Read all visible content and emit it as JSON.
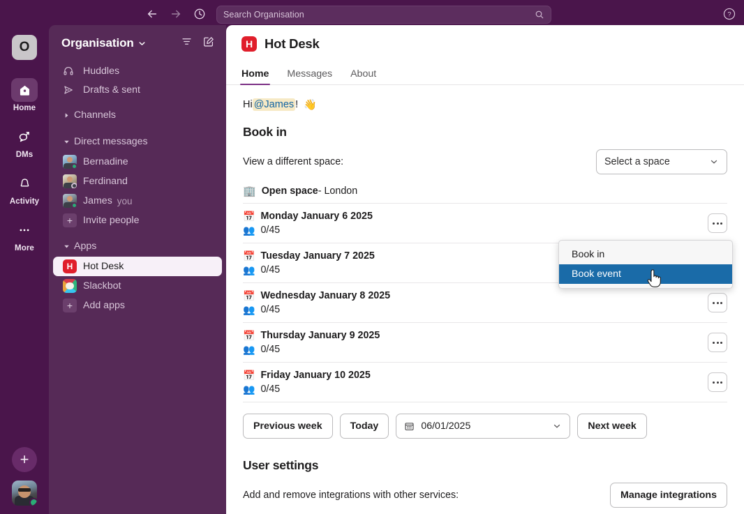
{
  "topbar": {
    "back_icon": "arrow-left-icon",
    "forward_icon": "arrow-right-icon",
    "history_icon": "clock-icon",
    "search_placeholder": "Search Organisation",
    "search_icon": "search-icon",
    "help_label": "?"
  },
  "rail": {
    "workspace_initial": "O",
    "items": [
      {
        "label": "Home",
        "icon": "home-icon",
        "active": true
      },
      {
        "label": "DMs",
        "icon": "dm-icon",
        "active": false
      },
      {
        "label": "Activity",
        "icon": "bell-icon",
        "active": false
      },
      {
        "label": "More",
        "icon": "ellipsis-icon",
        "active": false
      }
    ],
    "new_label": "+"
  },
  "sidebar": {
    "title": "Organisation",
    "caret_icon": "chevron-down-icon",
    "filter_icon": "filter-icon",
    "compose_icon": "compose-icon",
    "top_items": [
      {
        "label": "Huddles",
        "icon": "headphones-icon"
      },
      {
        "label": "Drafts & sent",
        "icon": "paper-plane-icon"
      }
    ],
    "channels_section": {
      "label": "Channels",
      "expanded": false
    },
    "dm_section": {
      "label": "Direct messages",
      "expanded": true
    },
    "dms": [
      {
        "label": "Bernadine",
        "presence": "active",
        "suffix": ""
      },
      {
        "label": "Ferdinand",
        "presence": "away",
        "suffix": ""
      },
      {
        "label": "James",
        "presence": "active",
        "suffix": "you"
      }
    ],
    "invite_label": "Invite people",
    "apps_section": {
      "label": "Apps",
      "expanded": true
    },
    "apps": [
      {
        "label": "Hot Desk",
        "icon": "hot-desk-app-icon",
        "active": true
      },
      {
        "label": "Slackbot",
        "icon": "slackbot-icon",
        "active": false
      }
    ],
    "add_apps_label": "Add apps"
  },
  "main": {
    "app_title": "Hot Desk",
    "app_initial": "H",
    "tabs": [
      {
        "label": "Home",
        "active": true
      },
      {
        "label": "Messages",
        "active": false
      },
      {
        "label": "About",
        "active": false
      }
    ],
    "greeting_prefix": "Hi ",
    "greeting_mention": "@James",
    "greeting_suffix": "!",
    "greeting_emoji": "👋",
    "book_in_heading": "Book in",
    "view_space_label": "View a different space:",
    "space_select_value": "Select a space",
    "space_select_caret": "chevron-down-icon",
    "space_emoji": "🏢",
    "space_name": "Open space",
    "space_location": " - London",
    "day_emoji": "📅",
    "people_emoji": "👥",
    "days": [
      {
        "date": "Monday January 6 2025",
        "count": "0/45"
      },
      {
        "date": "Tuesday January 7 2025",
        "count": "0/45"
      },
      {
        "date": "Wednesday January 8 2025",
        "count": "0/45"
      },
      {
        "date": "Thursday January 9 2025",
        "count": "0/45"
      },
      {
        "date": "Friday January 10 2025",
        "count": "0/45"
      }
    ],
    "prev_week_label": "Previous week",
    "today_label": "Today",
    "date_value": "06/01/2025",
    "date_icon": "calendar-icon",
    "next_week_label": "Next week",
    "user_settings_heading": "User settings",
    "integrations_label": "Add and remove integrations with other services:",
    "manage_integrations_label": "Manage integrations"
  },
  "context_menu": {
    "items": [
      {
        "label": "Book in",
        "selected": false
      },
      {
        "label": "Book event",
        "selected": true
      }
    ],
    "highlight_color": "#1a6ba8"
  },
  "theme": {
    "chrome": "#4a154b",
    "sidebar": "#562a57",
    "accent": "#7c3085",
    "app_red": "#e01e2b",
    "presence_green": "#2bac76",
    "mention_blue": "#1164a3"
  }
}
